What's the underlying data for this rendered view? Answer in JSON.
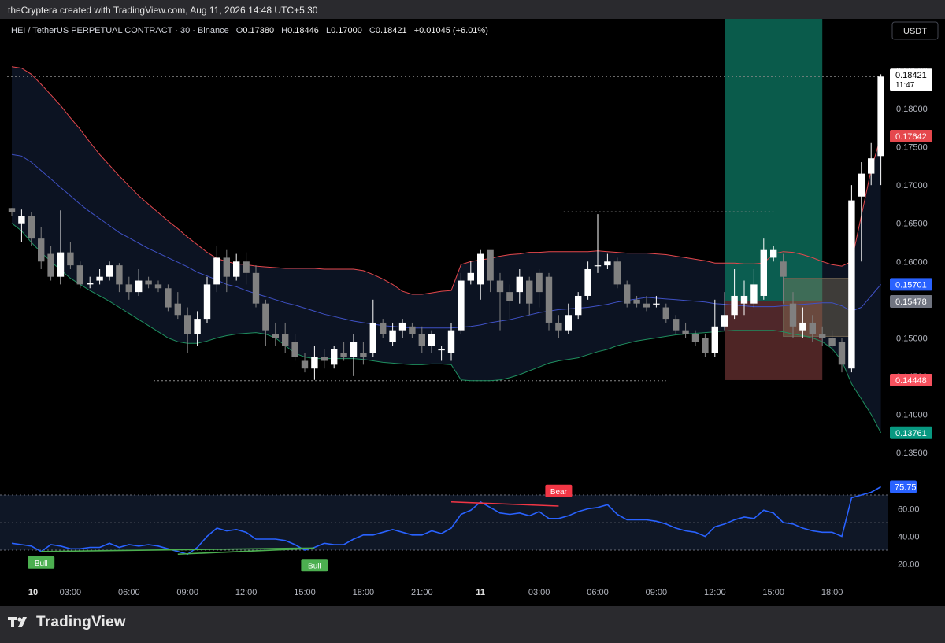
{
  "watermark": "theCryptera created with TradingView.com, Aug 11, 2026 14:48 UTC+5:30",
  "header": {
    "symbol": "HEI / TetherUS PERPETUAL CONTRACT · 30 · Binance",
    "o_label": "O",
    "o_value": "0.17380",
    "h_label": "H",
    "h_value": "0.18446",
    "l_label": "L",
    "l_value": "0.17000",
    "c_label": "C",
    "c_value": "0.18421",
    "change": "+0.01045 (+6.01%)"
  },
  "currency_button": "USDT",
  "footer": {
    "brand": "TradingView"
  },
  "colors": {
    "up": "#ffffff",
    "down": "#808080",
    "upper_band": "#e5484d",
    "middle_band": "#3f51c5",
    "lower_band": "#1f8f5f",
    "rsi": "#2962ff",
    "bull": "#4caf50",
    "bear": "#f23645",
    "tp_zone": "#0c6b58",
    "sl_zone": "#5c2c2c"
  },
  "chart_data": {
    "type": "candlestick",
    "y_axis": {
      "ylim": [
        0.1315,
        0.1866
      ],
      "ticks": [
        "0.18500",
        "0.18000",
        "0.17500",
        "0.17000",
        "0.16500",
        "0.16000",
        "0.15500",
        "0.15000",
        "0.14500",
        "0.14000",
        "0.13500"
      ]
    },
    "x_axis": {
      "ticks": [
        {
          "label": "10",
          "x": 0
        },
        {
          "label": "03:00",
          "x": 6
        },
        {
          "label": "06:00",
          "x": 12
        },
        {
          "label": "09:00",
          "x": 18
        },
        {
          "label": "12:00",
          "x": 24
        },
        {
          "label": "15:00",
          "x": 30
        },
        {
          "label": "18:00",
          "x": 36
        },
        {
          "label": "21:00",
          "x": 42
        },
        {
          "label": "11",
          "x": 48
        },
        {
          "label": "03:00",
          "x": 54
        },
        {
          "label": "06:00",
          "x": 60
        },
        {
          "label": "09:00",
          "x": 66
        },
        {
          "label": "12:00",
          "x": 72
        },
        {
          "label": "15:00",
          "x": 78
        },
        {
          "label": "18:00",
          "x": 84
        }
      ]
    },
    "price_labels": [
      {
        "value": "0.18421",
        "sub": "11:47",
        "kind": "last"
      },
      {
        "value": "0.17642",
        "kind": "upper"
      },
      {
        "value": "0.15701",
        "kind": "middle"
      },
      {
        "value": "0.15478",
        "kind": "entry"
      },
      {
        "value": "0.14448",
        "kind": "stop"
      },
      {
        "value": "0.13761",
        "kind": "lower"
      }
    ],
    "candles": [
      [
        0.167,
        0.1665,
        0.167,
        0.166
      ],
      [
        0.165,
        0.166,
        0.1668,
        0.1625
      ],
      [
        0.166,
        0.163,
        0.1665,
        0.162
      ],
      [
        0.163,
        0.16,
        0.1645,
        0.159
      ],
      [
        0.161,
        0.158,
        0.162,
        0.1575
      ],
      [
        0.158,
        0.1612,
        0.1667,
        0.157
      ],
      [
        0.1612,
        0.1595,
        0.1625,
        0.159
      ],
      [
        0.1595,
        0.157,
        0.16,
        0.1565
      ],
      [
        0.157,
        0.1572,
        0.158,
        0.1565
      ],
      [
        0.1575,
        0.158,
        0.159,
        0.157
      ],
      [
        0.158,
        0.1595,
        0.16,
        0.1575
      ],
      [
        0.1595,
        0.157,
        0.1598,
        0.156
      ],
      [
        0.157,
        0.156,
        0.158,
        0.155
      ],
      [
        0.156,
        0.1575,
        0.159,
        0.1555
      ],
      [
        0.1575,
        0.157,
        0.158,
        0.1565
      ],
      [
        0.157,
        0.1565,
        0.1575,
        0.156
      ],
      [
        0.1565,
        0.154,
        0.157,
        0.1535
      ],
      [
        0.1545,
        0.153,
        0.156,
        0.1525
      ],
      [
        0.153,
        0.1505,
        0.154,
        0.148
      ],
      [
        0.1505,
        0.1525,
        0.1535,
        0.149
      ],
      [
        0.1525,
        0.157,
        0.158,
        0.152
      ],
      [
        0.157,
        0.1605,
        0.162,
        0.156
      ],
      [
        0.1605,
        0.158,
        0.1615,
        0.156
      ],
      [
        0.158,
        0.16,
        0.161,
        0.1575
      ],
      [
        0.16,
        0.1585,
        0.1612,
        0.157
      ],
      [
        0.1585,
        0.1545,
        0.1595,
        0.154
      ],
      [
        0.1545,
        0.151,
        0.155,
        0.149
      ],
      [
        0.1505,
        0.15,
        0.152,
        0.149
      ],
      [
        0.1505,
        0.149,
        0.152,
        0.148
      ],
      [
        0.1495,
        0.1475,
        0.1505,
        0.147
      ],
      [
        0.147,
        0.146,
        0.148,
        0.1455
      ],
      [
        0.146,
        0.1475,
        0.149,
        0.1445
      ],
      [
        0.1475,
        0.147,
        0.1485,
        0.146
      ],
      [
        0.1465,
        0.1485,
        0.149,
        0.146
      ],
      [
        0.148,
        0.1475,
        0.1495,
        0.147
      ],
      [
        0.1475,
        0.1495,
        0.1505,
        0.145
      ],
      [
        0.148,
        0.1475,
        0.1495,
        0.1465
      ],
      [
        0.148,
        0.152,
        0.155,
        0.1475
      ],
      [
        0.152,
        0.1505,
        0.1525,
        0.15
      ],
      [
        0.1495,
        0.151,
        0.152,
        0.149
      ],
      [
        0.151,
        0.152,
        0.1525,
        0.15
      ],
      [
        0.1515,
        0.1505,
        0.152,
        0.15
      ],
      [
        0.1505,
        0.149,
        0.1515,
        0.148
      ],
      [
        0.149,
        0.1505,
        0.151,
        0.148
      ],
      [
        0.1485,
        0.1485,
        0.149,
        0.147
      ],
      [
        0.148,
        0.151,
        0.152,
        0.147
      ],
      [
        0.151,
        0.1575,
        0.1585,
        0.1505
      ],
      [
        0.1575,
        0.1585,
        0.16,
        0.157
      ],
      [
        0.157,
        0.161,
        0.1615,
        0.155
      ],
      [
        0.1615,
        0.1575,
        0.161,
        0.156
      ],
      [
        0.1575,
        0.156,
        0.1585,
        0.151
      ],
      [
        0.156,
        0.1548,
        0.157,
        0.1525
      ],
      [
        0.156,
        0.158,
        0.159,
        0.1545
      ],
      [
        0.1575,
        0.1545,
        0.158,
        0.153
      ],
      [
        0.1585,
        0.156,
        0.159,
        0.154
      ],
      [
        0.158,
        0.152,
        0.1585,
        0.151
      ],
      [
        0.152,
        0.151,
        0.153,
        0.15
      ],
      [
        0.151,
        0.153,
        0.1545,
        0.1505
      ],
      [
        0.153,
        0.1555,
        0.156,
        0.1525
      ],
      [
        0.1555,
        0.159,
        0.16,
        0.155
      ],
      [
        0.1595,
        0.1595,
        0.1662,
        0.1585
      ],
      [
        0.1595,
        0.16,
        0.161,
        0.159
      ],
      [
        0.16,
        0.157,
        0.1605,
        0.1565
      ],
      [
        0.157,
        0.1545,
        0.1575,
        0.154
      ],
      [
        0.155,
        0.1545,
        0.1555,
        0.154
      ],
      [
        0.1545,
        0.154,
        0.1555,
        0.1535
      ],
      [
        0.1545,
        0.1545,
        0.1555,
        0.154
      ],
      [
        0.154,
        0.1525,
        0.1545,
        0.152
      ],
      [
        0.1525,
        0.151,
        0.153,
        0.1505
      ],
      [
        0.151,
        0.1505,
        0.152,
        0.15
      ],
      [
        0.1505,
        0.1495,
        0.151,
        0.149
      ],
      [
        0.15,
        0.148,
        0.1505,
        0.1475
      ],
      [
        0.148,
        0.1515,
        0.155,
        0.1475
      ],
      [
        0.1515,
        0.153,
        0.156,
        0.151
      ],
      [
        0.153,
        0.1555,
        0.159,
        0.1525
      ],
      [
        0.1545,
        0.1555,
        0.1575,
        0.153
      ],
      [
        0.1545,
        0.157,
        0.159,
        0.154
      ],
      [
        0.1555,
        0.1615,
        0.163,
        0.155
      ],
      [
        0.1605,
        0.1615,
        0.162,
        0.16
      ],
      [
        0.16,
        0.158,
        0.161,
        0.1545
      ],
      [
        0.1545,
        0.1515,
        0.156,
        0.15
      ],
      [
        0.151,
        0.152,
        0.154,
        0.15
      ],
      [
        0.152,
        0.1505,
        0.153,
        0.1495
      ],
      [
        0.1505,
        0.15,
        0.1515,
        0.149
      ],
      [
        0.15,
        0.149,
        0.151,
        0.148
      ],
      [
        0.1495,
        0.1465,
        0.15,
        0.1455
      ],
      [
        0.146,
        0.168,
        0.17,
        0.1455
      ],
      [
        0.1685,
        0.1715,
        0.173,
        0.16
      ],
      [
        0.1715,
        0.1735,
        0.1755,
        0.17
      ],
      [
        0.1738,
        0.1842,
        0.1845,
        0.17
      ]
    ],
    "bollinger": {
      "upper": [
        0.1855,
        0.1853,
        0.1845,
        0.1832,
        0.1818,
        0.1804,
        0.1788,
        0.1773,
        0.1756,
        0.174,
        0.1726,
        0.1712,
        0.1699,
        0.1686,
        0.1675,
        0.1664,
        0.1653,
        0.1643,
        0.1632,
        0.1622,
        0.1612,
        0.1604,
        0.16,
        0.1597,
        0.1596,
        0.1594,
        0.1593,
        0.1592,
        0.1591,
        0.1591,
        0.1591,
        0.1591,
        0.159,
        0.159,
        0.159,
        0.159,
        0.1588,
        0.1583,
        0.1577,
        0.157,
        0.1561,
        0.1557,
        0.1557,
        0.1559,
        0.1561,
        0.1562,
        0.1596,
        0.16,
        0.1602,
        0.1604,
        0.1607,
        0.1609,
        0.161,
        0.1612,
        0.1612,
        0.1613,
        0.1613,
        0.1613,
        0.1613,
        0.1613,
        0.1614,
        0.1613,
        0.1612,
        0.1611,
        0.1611,
        0.1611,
        0.161,
        0.1609,
        0.1607,
        0.1605,
        0.1603,
        0.1601,
        0.1598,
        0.1598,
        0.1598,
        0.1597,
        0.1597,
        0.1598,
        0.161,
        0.1613,
        0.1612,
        0.1609,
        0.1605,
        0.16,
        0.1596,
        0.1594,
        0.16,
        0.166,
        0.172,
        0.1764
      ],
      "middle": [
        0.174,
        0.1738,
        0.173,
        0.1719,
        0.1708,
        0.1697,
        0.1686,
        0.1675,
        0.1665,
        0.1656,
        0.1647,
        0.1638,
        0.1631,
        0.1624,
        0.1617,
        0.1611,
        0.1605,
        0.1599,
        0.1593,
        0.1586,
        0.1581,
        0.1576,
        0.157,
        0.1567,
        0.1562,
        0.1558,
        0.1554,
        0.155,
        0.1546,
        0.1543,
        0.1539,
        0.1535,
        0.1531,
        0.1528,
        0.1525,
        0.1522,
        0.152,
        0.1518,
        0.1516,
        0.1515,
        0.1514,
        0.1513,
        0.1513,
        0.1513,
        0.1513,
        0.1513,
        0.1514,
        0.1515,
        0.1517,
        0.152,
        0.1522,
        0.1524,
        0.1527,
        0.153,
        0.1533,
        0.1535,
        0.1537,
        0.1538,
        0.1539,
        0.154,
        0.1542,
        0.1544,
        0.1547,
        0.1549,
        0.1551,
        0.1553,
        0.1552,
        0.1551,
        0.155,
        0.1549,
        0.1548,
        0.1547,
        0.1545,
        0.1544,
        0.1543,
        0.1542,
        0.1541,
        0.1541,
        0.1541,
        0.1542,
        0.1543,
        0.1544,
        0.1545,
        0.1546,
        0.1546,
        0.1542,
        0.1535,
        0.154,
        0.1555,
        0.157
      ],
      "lower": [
        0.165,
        0.164,
        0.1625,
        0.1612,
        0.16,
        0.1589,
        0.1578,
        0.157,
        0.1562,
        0.1555,
        0.1548,
        0.154,
        0.1532,
        0.1524,
        0.1516,
        0.1508,
        0.15,
        0.1495,
        0.1493,
        0.1493,
        0.1496,
        0.15,
        0.1503,
        0.1505,
        0.1506,
        0.1507,
        0.1505,
        0.15,
        0.149,
        0.148,
        0.1475,
        0.1473,
        0.1473,
        0.1473,
        0.1473,
        0.1473,
        0.1472,
        0.147,
        0.1468,
        0.1467,
        0.1466,
        0.1465,
        0.1465,
        0.1466,
        0.1466,
        0.1465,
        0.1445,
        0.1444,
        0.1444,
        0.1444,
        0.1445,
        0.1448,
        0.1452,
        0.1457,
        0.1462,
        0.1467,
        0.147,
        0.1472,
        0.1474,
        0.1478,
        0.1482,
        0.1485,
        0.149,
        0.1493,
        0.1496,
        0.1498,
        0.15,
        0.1502,
        0.1504,
        0.1505,
        0.1506,
        0.1507,
        0.1508,
        0.1509,
        0.151,
        0.151,
        0.151,
        0.151,
        0.151,
        0.1508,
        0.1505,
        0.1503,
        0.15,
        0.1495,
        0.1486,
        0.147,
        0.144,
        0.142,
        0.14,
        0.1376
      ]
    },
    "dotted_levels": [
      {
        "value": 0.18421,
        "x_from": 0,
        "x_to": 89
      },
      {
        "value": 0.1665,
        "x_from": 57,
        "x_to": 78
      },
      {
        "value": 0.1444,
        "x_from": 15,
        "x_to": 67
      }
    ],
    "position": {
      "x_from": 73,
      "x_to": 83,
      "target": 0.1866,
      "entry": 0.15478,
      "stop": 0.14448,
      "ghost_box": {
        "x_from": 79,
        "x_to": 86,
        "top": 0.1578,
        "bottom": 0.1502
      }
    },
    "rsi": {
      "ylim": [
        10,
        82
      ],
      "ticks": [
        "60.00",
        "40.00",
        "20.00"
      ],
      "band": [
        30,
        70
      ],
      "mid": 50,
      "last_label": "75.75",
      "values": [
        35,
        34,
        33,
        29,
        34,
        33,
        31,
        31,
        32,
        32,
        35,
        32,
        34,
        33,
        34,
        33,
        31,
        29,
        27,
        32,
        40,
        46,
        44,
        45,
        43,
        38,
        38,
        38,
        37,
        34,
        30,
        32,
        35,
        34,
        34,
        38,
        41,
        41,
        43,
        45,
        43,
        41,
        41,
        44,
        42,
        46,
        56,
        59,
        65,
        61,
        57,
        56,
        57,
        55,
        58,
        53,
        53,
        55,
        58,
        60,
        61,
        63,
        56,
        52,
        52,
        52,
        51,
        49,
        46,
        44,
        43,
        40,
        47,
        49,
        52,
        54,
        53,
        59,
        57,
        50,
        49,
        46,
        44,
        43,
        43,
        40,
        68,
        70,
        72,
        76
      ],
      "divergences": [
        {
          "kind": "bull",
          "label": "Bull",
          "x1": 3,
          "v1": 29,
          "x2": 31,
          "v2": 31.5,
          "label_at": 3
        },
        {
          "kind": "bull",
          "label": "Bull",
          "x1": 17,
          "v1": 27,
          "x2": 30,
          "v2": 31,
          "label_at": 31
        },
        {
          "kind": "bear",
          "label": "Bear",
          "x1": 45,
          "v1": 65,
          "x2": 56,
          "v2": 62,
          "label_at": 56
        }
      ]
    }
  }
}
